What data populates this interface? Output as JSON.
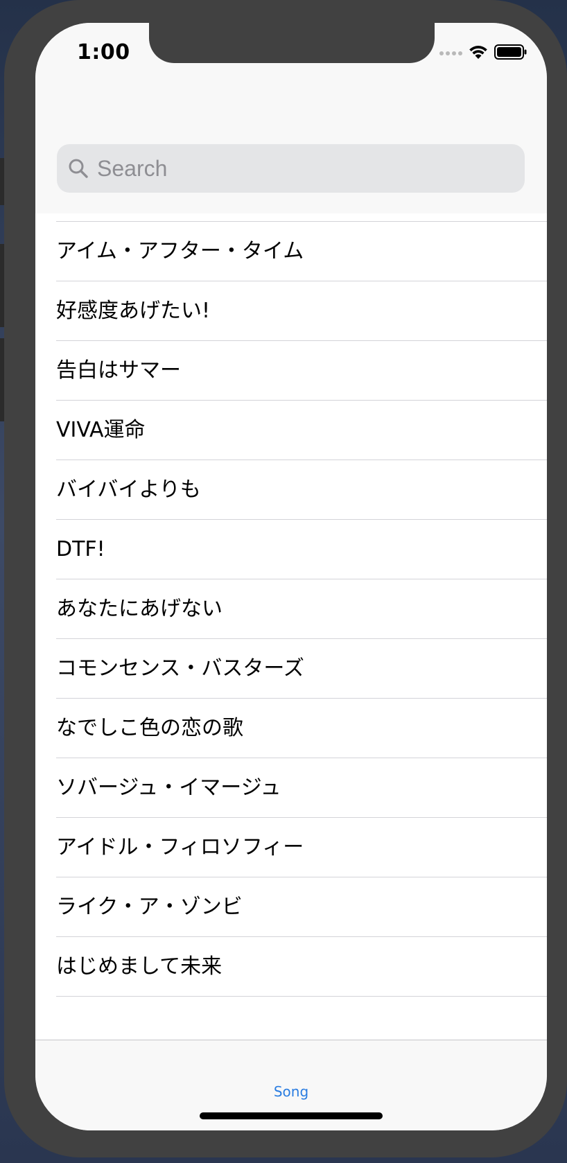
{
  "status_bar": {
    "time": "1:00",
    "icons": [
      "cellular-signal-icon",
      "wifi-icon",
      "battery-icon"
    ]
  },
  "search": {
    "placeholder": "Search",
    "icon": "search-icon"
  },
  "songs": [
    "アイム・アフター・タイム",
    "好感度あげたい!",
    "告白はサマー",
    "VIVA運命",
    "バイバイよりも",
    "DTF!",
    "あなたにあげない",
    "コモンセンス・バスターズ",
    "なでしこ色の恋の歌",
    "ソバージュ・イマージュ",
    "アイドル・フィロソフィー",
    "ライク・ア・ゾンビ",
    "はじめまして未来"
  ],
  "tab_bar": {
    "items": [
      {
        "label": "Song",
        "selected": true
      }
    ]
  },
  "colors": {
    "accent": "#2a7de1",
    "device_frame": "#414141",
    "nav_background": "#f8f8f8",
    "search_field": "#e4e5e7",
    "separator": "#d3d3d8"
  }
}
